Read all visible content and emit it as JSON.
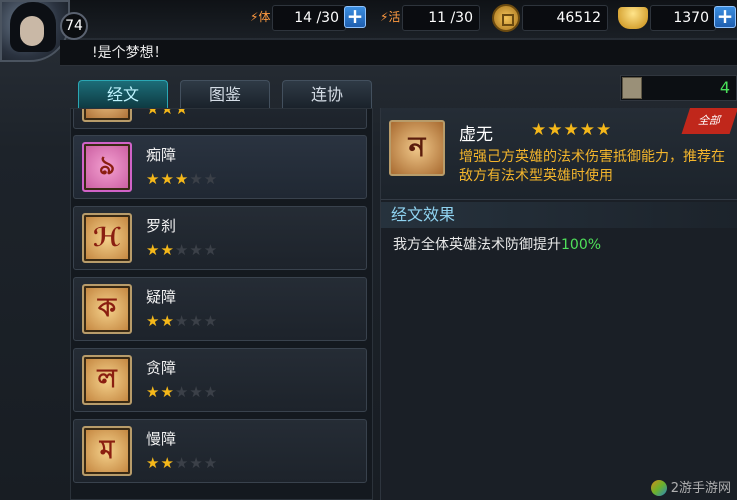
{
  "player": {
    "level": "74"
  },
  "resources": {
    "stamina": {
      "label": "体",
      "value": "14 /30"
    },
    "vitality": {
      "label": "活",
      "value": "11 /30"
    },
    "coins": {
      "value": "46512"
    },
    "gold": {
      "value": "1370"
    }
  },
  "marquee": "!是个梦想！",
  "tabs": [
    "经文",
    "图鉴",
    "连协"
  ],
  "scroll_count": "4",
  "list": [
    {
      "name": "痴障",
      "stars": 3,
      "glyph": "ঌ"
    },
    {
      "name": "罗刹",
      "stars": 2,
      "glyph": "ℋ"
    },
    {
      "name": "疑障",
      "stars": 2,
      "glyph": "ক"
    },
    {
      "name": "贪障",
      "stars": 2,
      "glyph": "ল"
    },
    {
      "name": "慢障",
      "stars": 2,
      "glyph": "ম"
    }
  ],
  "detail": {
    "name": "虚无",
    "stars": 5,
    "description": "增强己方英雄的法术伤害抵御能力，推荐在敌方有法术型英雄时使用",
    "badge": "全部",
    "section_title": "经文效果",
    "effect_text": "我方全体英雄法术防御提升",
    "effect_value": "100%"
  },
  "watermark": "2游手游网",
  "colors": {
    "star_on": "#f5b81a",
    "star_off": "#3b4048",
    "effect_green": "#4fe05a",
    "desc_orange": "#f3b52c"
  }
}
